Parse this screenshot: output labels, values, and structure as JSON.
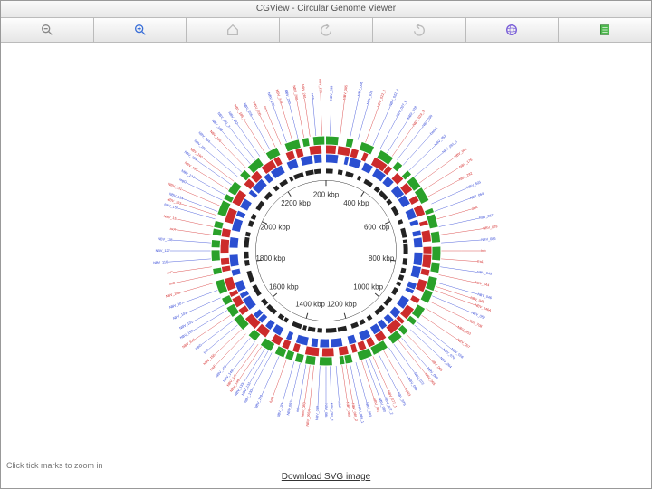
{
  "window": {
    "title": "CGView - Circular Genome Viewer"
  },
  "toolbar": {
    "zoom_out": "Zoom Out",
    "zoom_in": "Zoom In",
    "home": "Home",
    "undo": "Back",
    "redo": "Forward",
    "globe": "Full View",
    "export": "Export"
  },
  "hint_text": "Click tick marks to zoom in",
  "download_link": "Download SVG image",
  "ticks": [
    {
      "pos": 0,
      "label": "200 kbp"
    },
    {
      "pos": 1,
      "label": "400 kbp"
    },
    {
      "pos": 2,
      "label": "600 kbp"
    },
    {
      "pos": 3,
      "label": "800 kbp"
    },
    {
      "pos": 4,
      "label": "1000 kbp"
    },
    {
      "pos": 5,
      "label": "1200 kbp"
    },
    {
      "pos": 6,
      "label": "1400 kbp"
    },
    {
      "pos": 7,
      "label": "1600 kbp"
    },
    {
      "pos": 8,
      "label": "1800 kbp"
    },
    {
      "pos": 9,
      "label": "2000 kbp"
    },
    {
      "pos": 10,
      "label": "2200 kbp"
    }
  ],
  "tracks": [
    {
      "name": "outer-green",
      "r": 118,
      "w": 9,
      "color": "#2aa12a"
    },
    {
      "name": "mid-red",
      "r": 108,
      "w": 9,
      "color": "#cc2b2b"
    },
    {
      "name": "inner-blue",
      "r": 98,
      "w": 9,
      "color": "#2b4fd1"
    },
    {
      "name": "ticks-black",
      "r": 86,
      "w": 5,
      "color": "#222"
    }
  ],
  "feature_labels": [
    {
      "a": 2,
      "c": "b",
      "t": "NBV_299"
    },
    {
      "a": 7,
      "c": "r",
      "t": "NBV_305"
    },
    {
      "a": 12,
      "c": "b",
      "t": "NBV_006"
    },
    {
      "a": 16,
      "c": "b",
      "t": "NBV_016"
    },
    {
      "a": 20,
      "c": "r",
      "t": "NBV_022_2"
    },
    {
      "a": 24,
      "c": "b",
      "t": "NBV_022_4"
    },
    {
      "a": 28,
      "c": "b",
      "t": "NBV_027_6"
    },
    {
      "a": 32,
      "c": "b",
      "t": "NBV_028"
    },
    {
      "a": 35,
      "c": "r",
      "t": "NBV_029_3"
    },
    {
      "a": 38,
      "c": "b",
      "t": "NBV_030"
    },
    {
      "a": 42,
      "c": "b",
      "t": "base1"
    },
    {
      "a": 46,
      "c": "b",
      "t": "NBV_052"
    },
    {
      "a": 50,
      "c": "b",
      "t": "NBV_061_1"
    },
    {
      "a": 54,
      "c": "r",
      "t": "NBV_066"
    },
    {
      "a": 58,
      "c": "r",
      "t": "NBV_176"
    },
    {
      "a": 62,
      "c": "r",
      "t": "NBV_282"
    },
    {
      "a": 66,
      "c": "b",
      "t": "NBV_503"
    },
    {
      "a": 70,
      "c": "b",
      "t": "NBV_064"
    },
    {
      "a": 74,
      "c": "r",
      "t": "daA"
    },
    {
      "a": 78,
      "c": "b",
      "t": "NBV_067"
    },
    {
      "a": 82,
      "c": "r",
      "t": "NBV_079"
    },
    {
      "a": 86,
      "c": "b",
      "t": "NBV_086"
    },
    {
      "a": 90,
      "c": "r",
      "t": "hrb"
    },
    {
      "a": 94,
      "c": "r",
      "t": "fra1"
    },
    {
      "a": 98,
      "c": "b",
      "t": "NBV_043"
    },
    {
      "a": 102,
      "c": "r",
      "t": "NBV_044"
    },
    {
      "a": 106,
      "c": "b",
      "t": "NBV_046"
    },
    {
      "a": 108,
      "c": "r",
      "t": "NBV_048"
    },
    {
      "a": 110,
      "c": "r",
      "t": "NBV_046A"
    },
    {
      "a": 113,
      "c": "b",
      "t": "NBV_052"
    },
    {
      "a": 116,
      "c": "r",
      "t": "XbV_708"
    },
    {
      "a": 120,
      "c": "r",
      "t": "NBV_053"
    },
    {
      "a": 124,
      "c": "r",
      "t": "NBV_057"
    },
    {
      "a": 128,
      "c": "b",
      "t": "NBV_058"
    },
    {
      "a": 130,
      "c": "b",
      "t": "NBV_070"
    },
    {
      "a": 133,
      "c": "b",
      "t": "NBV_064"
    },
    {
      "a": 136,
      "c": "r",
      "t": "NBV_065"
    },
    {
      "a": 139,
      "c": "b",
      "t": "NBV_069"
    },
    {
      "a": 141,
      "c": "r",
      "t": "NBV_065"
    },
    {
      "a": 144,
      "c": "b",
      "t": "NBV_072"
    },
    {
      "a": 147,
      "c": "b",
      "t": "NBV_068"
    },
    {
      "a": 150,
      "c": "r",
      "t": "opR3"
    },
    {
      "a": 153,
      "c": "b",
      "t": "NBV_076"
    },
    {
      "a": 156,
      "c": "r",
      "t": "NBV_077_1"
    },
    {
      "a": 158,
      "c": "b",
      "t": "NBV_077_2"
    },
    {
      "a": 160,
      "c": "b",
      "t": "NBV_080"
    },
    {
      "a": 162,
      "c": "r",
      "t": "NBV_081"
    },
    {
      "a": 165,
      "c": "b",
      "t": "NBV_083"
    },
    {
      "a": 168,
      "c": "b",
      "t": "NBV_084_1"
    },
    {
      "a": 170,
      "c": "r",
      "t": "NBV_084_2"
    },
    {
      "a": 172,
      "c": "r",
      "t": "NBV_085"
    },
    {
      "a": 175,
      "c": "b",
      "t": "mhA"
    },
    {
      "a": 178,
      "c": "b",
      "t": "NBV_087_1"
    },
    {
      "a": 180,
      "c": "b",
      "t": "NBV_088"
    },
    {
      "a": 183,
      "c": "b",
      "t": "NBV_089"
    },
    {
      "a": 186,
      "c": "r",
      "t": "NBV_093A"
    },
    {
      "a": 188,
      "c": "r",
      "t": "NBV_083"
    },
    {
      "a": 190,
      "c": "b",
      "t": "mb"
    },
    {
      "a": 193,
      "c": "b",
      "t": "NBV_097"
    },
    {
      "a": 196,
      "c": "b",
      "t": "NBV_120"
    },
    {
      "a": 200,
      "c": "r",
      "t": "fusA"
    },
    {
      "a": 204,
      "c": "b",
      "t": "NBV_129"
    },
    {
      "a": 208,
      "c": "b",
      "t": "NBV_130"
    },
    {
      "a": 210,
      "c": "b",
      "t": "NBV_132"
    },
    {
      "a": 212,
      "c": "b",
      "t": "NBV_133"
    },
    {
      "a": 214,
      "c": "r",
      "t": "NBV_146"
    },
    {
      "a": 216,
      "c": "r",
      "t": "NBV_147"
    },
    {
      "a": 218,
      "c": "b",
      "t": "NBV_149"
    },
    {
      "a": 221,
      "c": "b",
      "t": "NBV_158"
    },
    {
      "a": 224,
      "c": "r",
      "t": "repF"
    },
    {
      "a": 227,
      "c": "r",
      "t": "NBV_155"
    },
    {
      "a": 230,
      "c": "b",
      "t": "tulA"
    },
    {
      "a": 233,
      "c": "b",
      "t": "repG"
    },
    {
      "a": 236,
      "c": "r",
      "t": "NBV_615"
    },
    {
      "a": 239,
      "c": "b",
      "t": "NBV_157"
    },
    {
      "a": 242,
      "c": "b",
      "t": "NBV_101"
    },
    {
      "a": 246,
      "c": "b",
      "t": "NBV_103"
    },
    {
      "a": 250,
      "c": "b",
      "t": "NBV_107"
    },
    {
      "a": 254,
      "c": "r",
      "t": "NBV_108"
    },
    {
      "a": 258,
      "c": "r",
      "t": "oxB"
    },
    {
      "a": 262,
      "c": "r",
      "t": "oxC"
    },
    {
      "a": 266,
      "c": "b",
      "t": "NBV_116"
    },
    {
      "a": 270,
      "c": "b",
      "t": "NBV_127"
    },
    {
      "a": 274,
      "c": "b",
      "t": "NBV_128"
    },
    {
      "a": 278,
      "c": "r",
      "t": "axA"
    },
    {
      "a": 282,
      "c": "r",
      "t": "NBV_151"
    },
    {
      "a": 286,
      "c": "b",
      "t": "NBV_152"
    },
    {
      "a": 288,
      "c": "r",
      "t": "NBV_153"
    },
    {
      "a": 290,
      "c": "b",
      "t": "NBV_154"
    },
    {
      "a": 293,
      "c": "r",
      "t": "NBV_131"
    },
    {
      "a": 296,
      "c": "b",
      "t": "regG"
    },
    {
      "a": 299,
      "c": "b",
      "t": "NBV_134"
    },
    {
      "a": 302,
      "c": "r",
      "t": "NBV_135"
    },
    {
      "a": 305,
      "c": "b",
      "t": "NBV_154"
    },
    {
      "a": 307,
      "c": "r",
      "t": "NBV_160"
    },
    {
      "a": 310,
      "c": "b",
      "t": "NBV_162"
    },
    {
      "a": 313,
      "c": "b",
      "t": "NBV_164"
    },
    {
      "a": 316,
      "c": "r",
      "t": "NBV_166"
    },
    {
      "a": 319,
      "c": "b",
      "t": "NBV_168"
    },
    {
      "a": 322,
      "c": "b",
      "t": "NBV_181_2"
    },
    {
      "a": 325,
      "c": "b",
      "t": "NBV_182"
    },
    {
      "a": 328,
      "c": "r",
      "t": "NBV_186_4"
    },
    {
      "a": 331,
      "c": "b",
      "t": "NBV_205"
    },
    {
      "a": 334,
      "c": "r",
      "t": "NBV_206"
    },
    {
      "a": 337,
      "c": "r",
      "t": "oxA"
    },
    {
      "a": 340,
      "c": "b",
      "t": "NBV_209"
    },
    {
      "a": 343,
      "c": "r",
      "t": "NBV_248"
    },
    {
      "a": 346,
      "c": "b",
      "t": "NBV_260"
    },
    {
      "a": 349,
      "c": "r",
      "t": "NBV_268"
    },
    {
      "a": 352,
      "c": "r",
      "t": "NBV_281"
    },
    {
      "a": 355,
      "c": "b",
      "t": "raM"
    },
    {
      "a": 358,
      "c": "r",
      "t": "NBV_295"
    }
  ]
}
